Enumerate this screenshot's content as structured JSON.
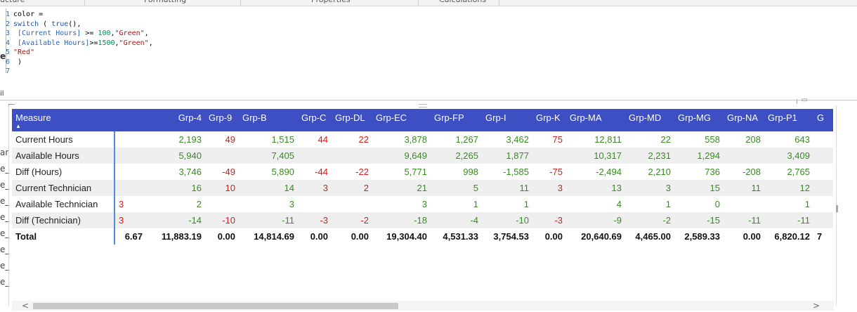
{
  "ribbon": {
    "tabs": [
      "ucture",
      "Formatting",
      "Properties",
      "Calculations"
    ]
  },
  "editor": {
    "line_numbers": [
      "1",
      "2",
      "3",
      "4",
      "5",
      "6",
      "7"
    ],
    "lines": [
      {
        "parts": [
          {
            "t": "color =",
            "c": ""
          }
        ]
      },
      {
        "parts": [
          {
            "t": "switch",
            "c": "kw"
          },
          {
            "t": " ( ",
            "c": ""
          },
          {
            "t": "true",
            "c": "kw"
          },
          {
            "t": "(),",
            "c": ""
          }
        ]
      },
      {
        "parts": [
          {
            "t": " [Current Hours]",
            "c": "ref"
          },
          {
            "t": " >= ",
            "c": ""
          },
          {
            "t": "100",
            "c": "num"
          },
          {
            "t": ",",
            "c": ""
          },
          {
            "t": "\"Green\"",
            "c": "str"
          },
          {
            "t": ",",
            "c": ""
          }
        ]
      },
      {
        "parts": [
          {
            "t": " [Available Hours]",
            "c": "ref"
          },
          {
            "t": ">=",
            "c": ""
          },
          {
            "t": "1500",
            "c": "num"
          },
          {
            "t": ",",
            "c": ""
          },
          {
            "t": "\"Green\"",
            "c": "str"
          },
          {
            "t": ",",
            "c": ""
          }
        ]
      },
      {
        "parts": [
          {
            "t": "\"Red\"",
            "c": "str"
          }
        ]
      },
      {
        "parts": [
          {
            "t": " )",
            "c": ""
          }
        ]
      },
      {
        "parts": [
          {
            "t": "",
            "c": ""
          }
        ]
      }
    ],
    "left_cut_labels": [
      "e",
      "il"
    ]
  },
  "left_field_stubs": [
    "ar",
    "e_",
    "e_",
    "e_",
    "e_",
    "e_",
    "e_",
    "e_",
    "e_"
  ],
  "matrix": {
    "corner_header": "Measure",
    "columns": [
      "",
      "Grp-4",
      "Grp-9",
      "Grp-B",
      "Grp-C",
      "Grp-DL",
      "Grp-EC",
      "Grp-FP",
      "Grp-I",
      "Grp-K",
      "Grp-MA",
      "Grp-MD",
      "Grp-MG",
      "Grp-NA",
      "Grp-P1",
      "G"
    ],
    "rows": [
      {
        "label": "Current Hours",
        "cells": [
          [
            "",
            ""
          ],
          [
            "2,193",
            "g"
          ],
          [
            "49",
            "r"
          ],
          [
            "1,515",
            "g"
          ],
          [
            "44",
            "r"
          ],
          [
            "22",
            "r"
          ],
          [
            "3,878",
            "g"
          ],
          [
            "1,267",
            "g"
          ],
          [
            "3,462",
            "g"
          ],
          [
            "75",
            "r"
          ],
          [
            "12,811",
            "g"
          ],
          [
            "22",
            "g"
          ],
          [
            "558",
            "g"
          ],
          [
            "208",
            "g"
          ],
          [
            "643",
            "g"
          ],
          [
            "",
            ""
          ]
        ]
      },
      {
        "label": "Available Hours",
        "cells": [
          [
            "",
            ""
          ],
          [
            "5,940",
            "g"
          ],
          [
            "",
            ""
          ],
          [
            "7,405",
            "g"
          ],
          [
            "",
            ""
          ],
          [
            "",
            ""
          ],
          [
            "9,649",
            "g"
          ],
          [
            "2,265",
            "g"
          ],
          [
            "1,877",
            "g"
          ],
          [
            "",
            ""
          ],
          [
            "10,317",
            "g"
          ],
          [
            "2,231",
            "g"
          ],
          [
            "1,294",
            "g"
          ],
          [
            "",
            ""
          ],
          [
            "3,409",
            "g"
          ],
          [
            "",
            ""
          ]
        ]
      },
      {
        "label": "Diff (Hours)",
        "cells": [
          [
            "",
            ""
          ],
          [
            "3,746",
            "g"
          ],
          [
            "-49",
            "r"
          ],
          [
            "5,890",
            "g"
          ],
          [
            "-44",
            "r"
          ],
          [
            "-22",
            "r"
          ],
          [
            "5,771",
            "g"
          ],
          [
            "998",
            "g"
          ],
          [
            "-1,585",
            "g"
          ],
          [
            "-75",
            "r"
          ],
          [
            "-2,494",
            "g"
          ],
          [
            "2,210",
            "g"
          ],
          [
            "736",
            "g"
          ],
          [
            "-208",
            "g"
          ],
          [
            "2,765",
            "g"
          ],
          [
            "",
            ""
          ]
        ]
      },
      {
        "label": "Current Technician",
        "cells": [
          [
            "",
            ""
          ],
          [
            "16",
            "g"
          ],
          [
            "10",
            "r"
          ],
          [
            "14",
            "g"
          ],
          [
            "3",
            "r"
          ],
          [
            "2",
            "r"
          ],
          [
            "21",
            "g"
          ],
          [
            "5",
            "g"
          ],
          [
            "11",
            "g"
          ],
          [
            "3",
            "r"
          ],
          [
            "13",
            "g"
          ],
          [
            "3",
            "g"
          ],
          [
            "15",
            "g"
          ],
          [
            "11",
            "g"
          ],
          [
            "12",
            "g"
          ],
          [
            "",
            ""
          ]
        ]
      },
      {
        "label": "Available Technician",
        "cells": [
          [
            "3",
            "r"
          ],
          [
            "2",
            "g"
          ],
          [
            "",
            ""
          ],
          [
            "3",
            "g"
          ],
          [
            "",
            ""
          ],
          [
            "",
            ""
          ],
          [
            "3",
            "g"
          ],
          [
            "1",
            "g"
          ],
          [
            "1",
            "g"
          ],
          [
            "",
            ""
          ],
          [
            "4",
            "g"
          ],
          [
            "1",
            "g"
          ],
          [
            "0",
            "g"
          ],
          [
            "",
            ""
          ],
          [
            "1",
            "g"
          ],
          [
            "",
            ""
          ]
        ]
      },
      {
        "label": "Diff (Technician)",
        "cells": [
          [
            "3",
            "r"
          ],
          [
            "-14",
            "g"
          ],
          [
            "-10",
            "r"
          ],
          [
            "-11",
            "g"
          ],
          [
            "-3",
            "r"
          ],
          [
            "-2",
            "r"
          ],
          [
            "-18",
            "g"
          ],
          [
            "-4",
            "g"
          ],
          [
            "-10",
            "g"
          ],
          [
            "-3",
            "r"
          ],
          [
            "-9",
            "g"
          ],
          [
            "-2",
            "g"
          ],
          [
            "-15",
            "g"
          ],
          [
            "-11",
            "g"
          ],
          [
            "-11",
            "g"
          ],
          [
            "",
            ""
          ]
        ]
      }
    ],
    "total": {
      "label": "Total",
      "cells": [
        "6.67",
        "11,883.19",
        "0.00",
        "14,814.69",
        "0.00",
        "0.00",
        "19,304.40",
        "4,531.33",
        "3,754.53",
        "0.00",
        "20,640.69",
        "4,465.00",
        "2,589.33",
        "0.00",
        "6,820.12",
        "7"
      ]
    }
  },
  "scrollbar": {
    "left": "<",
    "right": ">"
  }
}
